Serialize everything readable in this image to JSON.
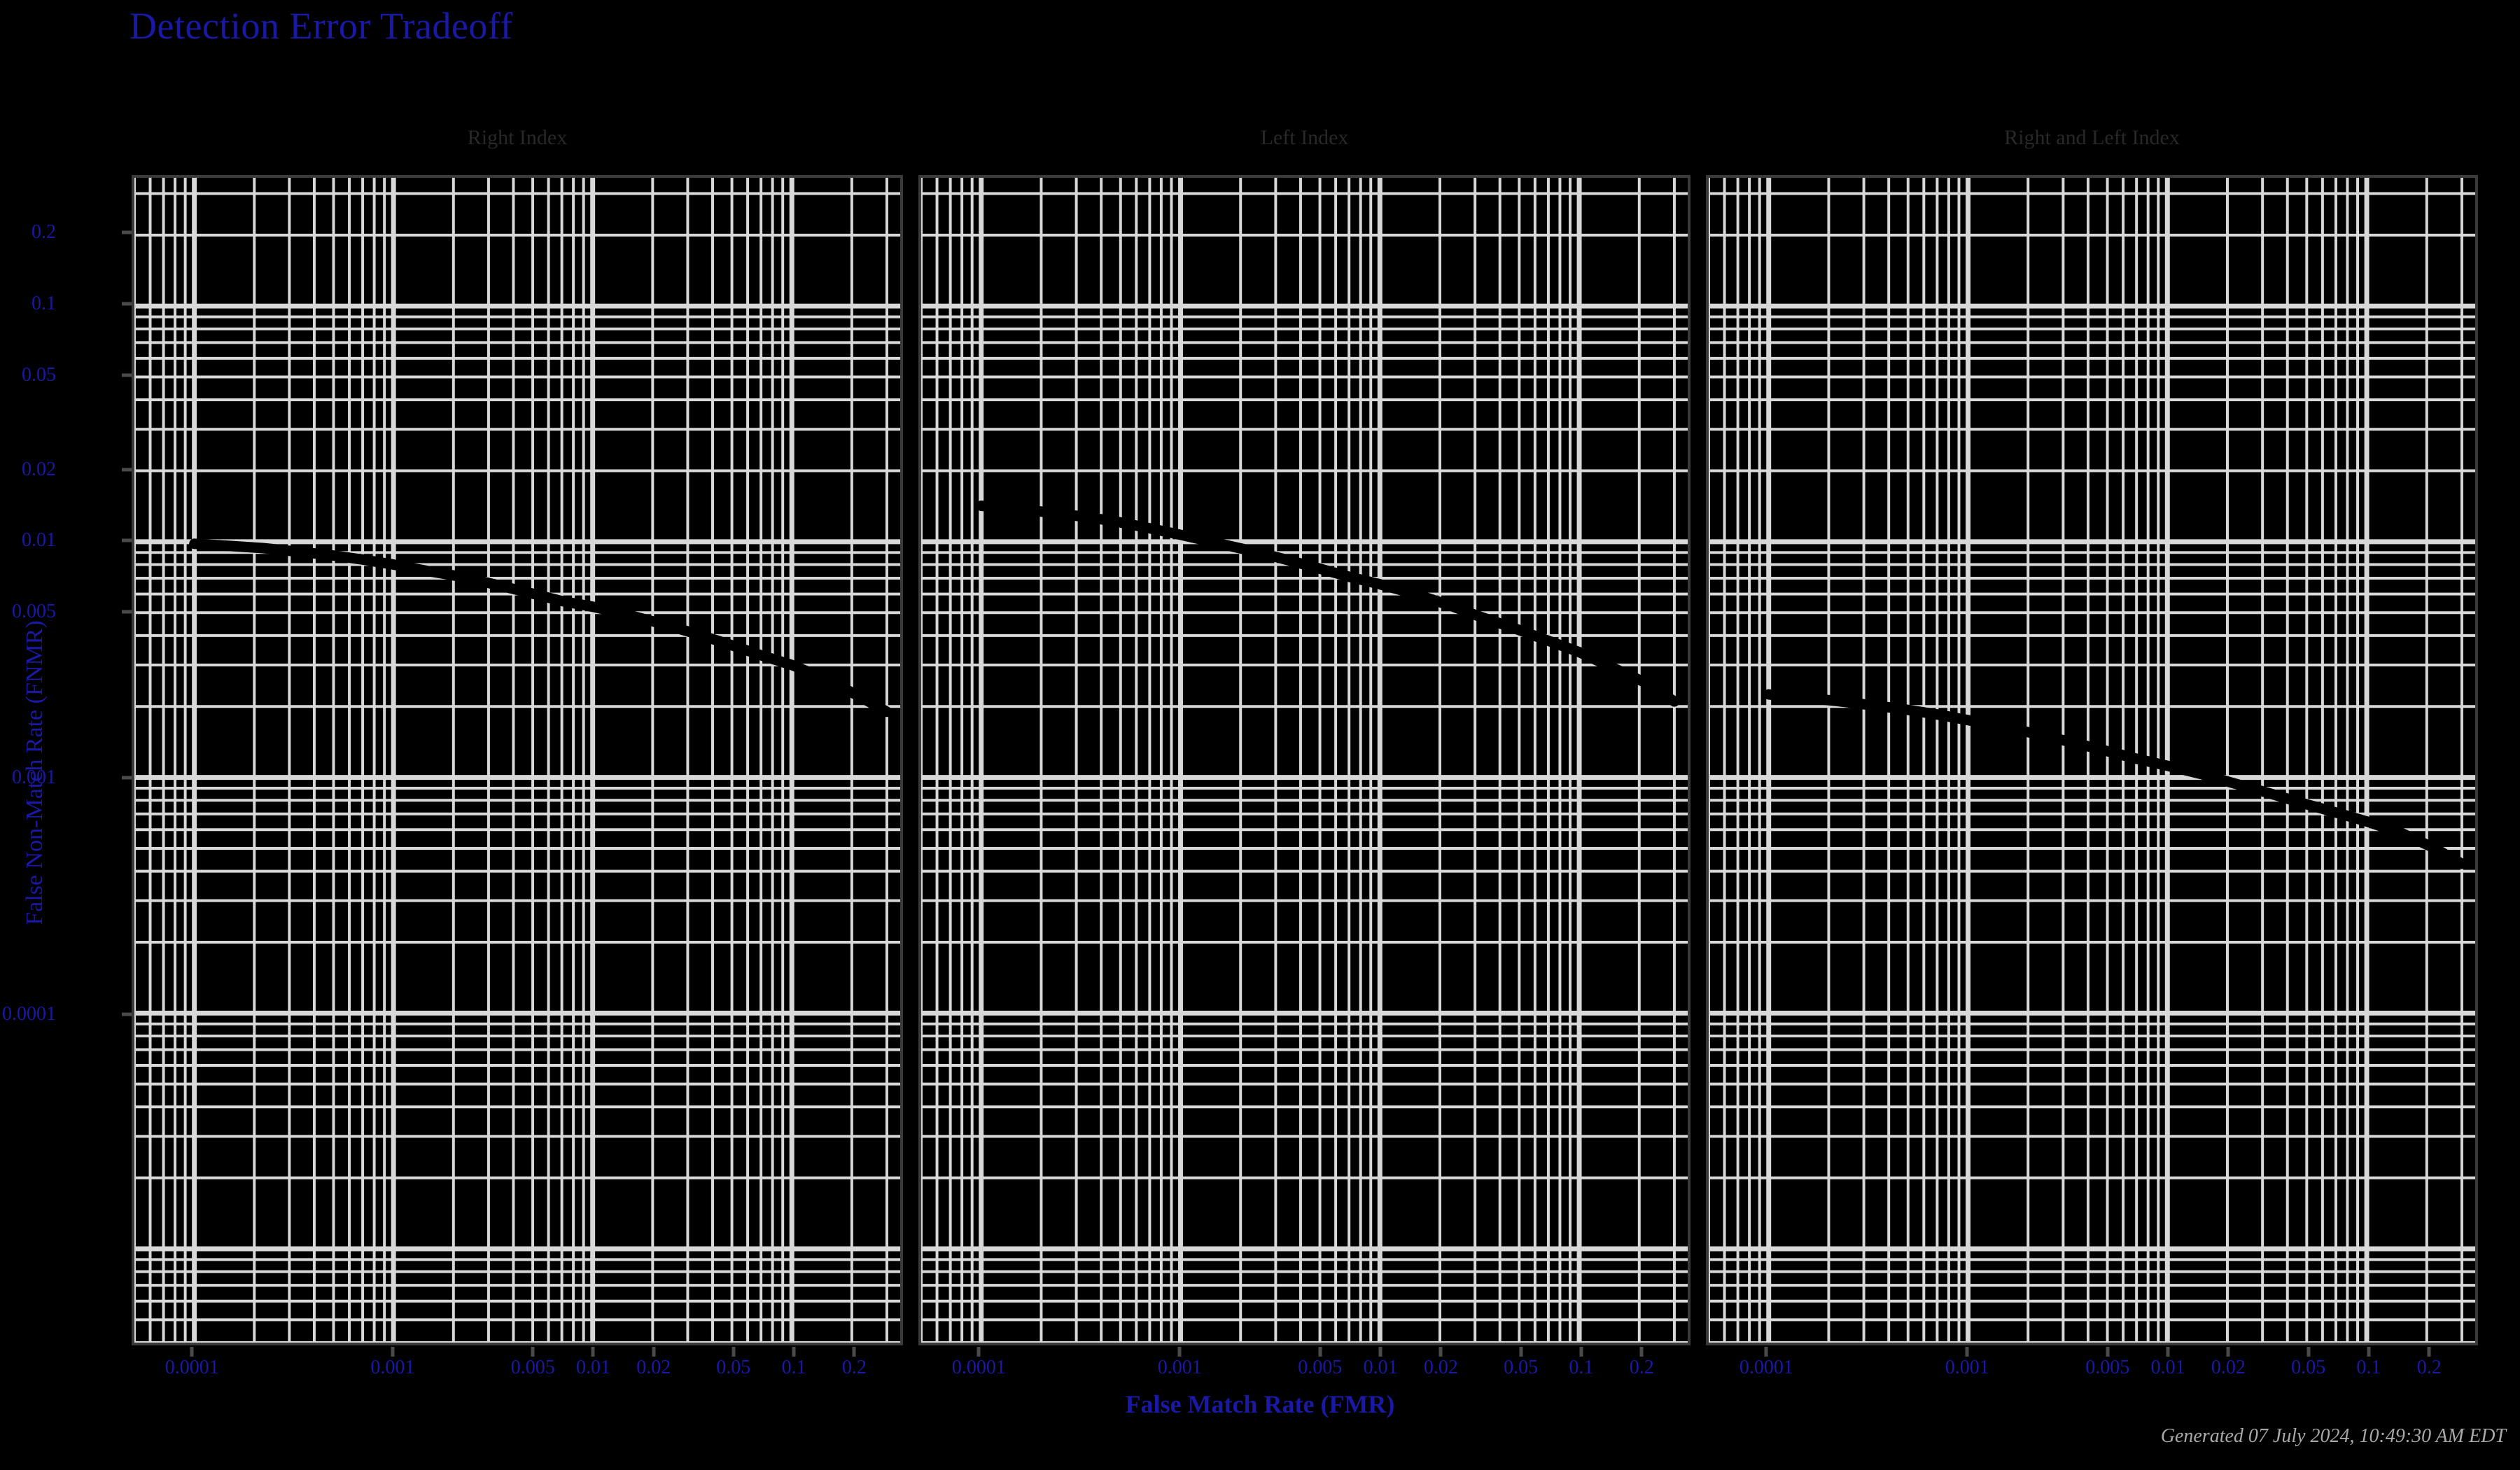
{
  "title": "Detection Error Tradeoff",
  "axis": {
    "x_label": "False Match Rate (FMR)",
    "y_label": "False Non-Match Rate (FNMR)"
  },
  "footer": "Generated 07 July 2024, 10:49:30 AM EDT",
  "colors": {
    "title": "#1a19a6",
    "axis_label": "#1a19a6",
    "tick_label": "#1a19a6",
    "panel_title": "#282828",
    "grid": "#d8d8d8",
    "curve": "#000000",
    "background": "#000000",
    "border": "#3a3a3a",
    "footer": "#a8a8a8"
  },
  "chart_data": {
    "type": "line",
    "title": "Detection Error Tradeoff",
    "xlabel": "False Match Rate (FMR)",
    "ylabel": "False Non-Match Rate (FNMR)",
    "xscale": "log",
    "yscale": "log",
    "grid": true,
    "legend": "none",
    "xlim": [
      5e-05,
      0.35
    ],
    "ylim": [
      4e-06,
      0.35
    ],
    "xticks": [
      0.0001,
      0.001,
      0.005,
      0.01,
      0.02,
      0.05,
      0.1,
      0.2
    ],
    "xtick_labels": [
      "0.0001",
      "0.001",
      "0.005",
      "0.01",
      "0.02",
      "0.05",
      "0.1",
      "0.2"
    ],
    "yticks": [
      0.2,
      0.1,
      0.05,
      0.02,
      0.01,
      0.005,
      0.001,
      0.0001
    ],
    "ytick_labels": [
      "0.2",
      "0.1",
      "0.05",
      "0.02",
      "0.01",
      "0.005",
      "0.001",
      "0.0001"
    ],
    "panels": [
      {
        "title": "Right Index",
        "x": [
          0.0001,
          0.00015,
          0.00022,
          0.00032,
          0.00047,
          0.0007,
          0.001,
          0.0015,
          0.0022,
          0.0032,
          0.0047,
          0.007,
          0.01,
          0.015,
          0.022,
          0.032,
          0.047,
          0.07,
          0.1,
          0.15,
          0.22,
          0.3
        ],
        "y": [
          0.0098,
          0.0096,
          0.0094,
          0.0091,
          0.0088,
          0.0084,
          0.008,
          0.0075,
          0.0071,
          0.0066,
          0.0061,
          0.0056,
          0.0053,
          0.0049,
          0.0045,
          0.0041,
          0.0037,
          0.0033,
          0.003,
          0.0026,
          0.0022,
          0.0019
        ]
      },
      {
        "title": "Left Index",
        "x": [
          0.0001,
          0.00015,
          0.00022,
          0.00032,
          0.00047,
          0.0007,
          0.001,
          0.0015,
          0.0022,
          0.0032,
          0.0047,
          0.007,
          0.01,
          0.015,
          0.022,
          0.032,
          0.047,
          0.07,
          0.1,
          0.15,
          0.22,
          0.3
        ],
        "y": [
          0.0142,
          0.0138,
          0.0133,
          0.0128,
          0.0122,
          0.0114,
          0.0107,
          0.0099,
          0.0092,
          0.0085,
          0.0078,
          0.0071,
          0.0066,
          0.006,
          0.0054,
          0.0048,
          0.0043,
          0.0038,
          0.0034,
          0.0029,
          0.0025,
          0.0021
        ]
      },
      {
        "title": "Right and Left Index",
        "x": [
          0.0001,
          0.00015,
          0.00022,
          0.00032,
          0.00047,
          0.0007,
          0.001,
          0.0015,
          0.0022,
          0.0032,
          0.0047,
          0.007,
          0.01,
          0.015,
          0.022,
          0.032,
          0.047,
          0.07,
          0.1,
          0.15,
          0.22,
          0.3
        ],
        "y": [
          0.00225,
          0.00218,
          0.00211,
          0.00203,
          0.00195,
          0.00185,
          0.00175,
          0.00164,
          0.00153,
          0.00142,
          0.00131,
          0.0012,
          0.00112,
          0.00103,
          0.00094,
          0.00086,
          0.00078,
          0.00071,
          0.00065,
          0.00058,
          0.0005,
          0.00043
        ]
      }
    ]
  }
}
